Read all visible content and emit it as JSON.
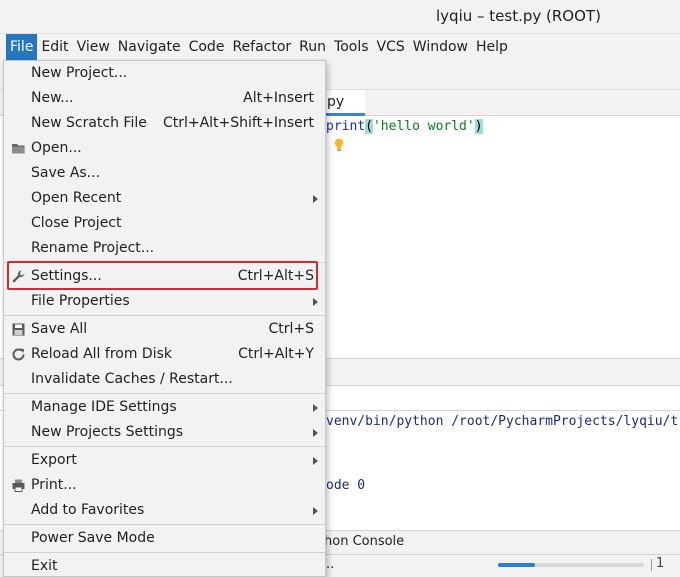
{
  "window": {
    "title": "lyqiu – test.py (ROOT)"
  },
  "menubar": {
    "items": [
      {
        "label": "File",
        "active": true
      },
      {
        "label": "Edit"
      },
      {
        "label": "View"
      },
      {
        "label": "Navigate"
      },
      {
        "label": "Code"
      },
      {
        "label": "Refactor"
      },
      {
        "label": "Run"
      },
      {
        "label": "Tools"
      },
      {
        "label": "VCS"
      },
      {
        "label": "Window"
      },
      {
        "label": "Help"
      }
    ]
  },
  "editor": {
    "tab_label": "py",
    "code": {
      "keyword": "print",
      "open_paren": "(",
      "string": "'hello world'",
      "close_paren": ")"
    },
    "bulb_icon": "lightbulb-icon"
  },
  "run_panel": {
    "command": "venv/bin/python /root/PycharmProjects/lyqiu/t",
    "exit_text": "ode 0"
  },
  "bottom_tabs": {
    "python_console": "hon Console"
  },
  "statusbar": {
    "ellipsis": "..",
    "right_text": "1",
    "progress": 0.25
  },
  "file_menu": {
    "items": [
      {
        "id": "new-project",
        "label": "New Project...",
        "shortcut": ""
      },
      {
        "id": "new",
        "label": "New...",
        "shortcut": "Alt+Insert"
      },
      {
        "id": "new-scratch-file",
        "label": "New Scratch File",
        "shortcut": "Ctrl+Alt+Shift+Insert"
      },
      {
        "id": "open",
        "label": "Open...",
        "shortcut": "",
        "icon": "folder-icon"
      },
      {
        "id": "save-as",
        "label": "Save As...",
        "shortcut": ""
      },
      {
        "id": "open-recent",
        "label": "Open Recent",
        "shortcut": "",
        "submenu": true
      },
      {
        "id": "close-project",
        "label": "Close Project",
        "shortcut": ""
      },
      {
        "id": "rename-project",
        "label": "Rename Project...",
        "shortcut": ""
      },
      {
        "id": "settings",
        "label": "Settings...",
        "shortcut": "Ctrl+Alt+S",
        "icon": "wrench-icon",
        "highlighted": true
      },
      {
        "id": "file-properties",
        "label": "File Properties",
        "shortcut": "",
        "submenu": true
      },
      {
        "id": "save-all",
        "label": "Save All",
        "shortcut": "Ctrl+S",
        "icon": "save-icon"
      },
      {
        "id": "reload-all",
        "label": "Reload All from Disk",
        "shortcut": "Ctrl+Alt+Y",
        "icon": "reload-icon"
      },
      {
        "id": "invalidate-caches",
        "label": "Invalidate Caches / Restart...",
        "shortcut": ""
      },
      {
        "id": "manage-ide-settings",
        "label": "Manage IDE Settings",
        "shortcut": "",
        "submenu": true
      },
      {
        "id": "new-projects-settings",
        "label": "New Projects Settings",
        "shortcut": "",
        "submenu": true
      },
      {
        "id": "export",
        "label": "Export",
        "shortcut": "",
        "submenu": true
      },
      {
        "id": "print",
        "label": "Print...",
        "shortcut": "",
        "icon": "printer-icon"
      },
      {
        "id": "add-to-favorites",
        "label": "Add to Favorites",
        "shortcut": "",
        "submenu": true
      },
      {
        "id": "power-save-mode",
        "label": "Power Save Mode",
        "shortcut": ""
      },
      {
        "id": "exit",
        "label": "Exit",
        "shortcut": ""
      }
    ]
  },
  "colors": {
    "menu_active": "#2675bf",
    "highlight_border": "#d72b2b",
    "menu_background": "#f2f2f2"
  }
}
